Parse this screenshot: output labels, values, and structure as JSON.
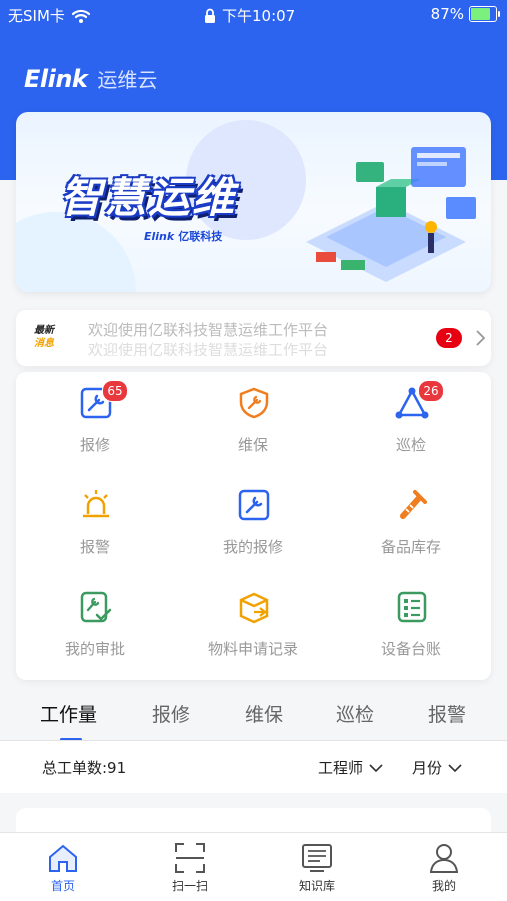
{
  "status_bar": {
    "carrier": "无SIM卡",
    "time": "下午10:07",
    "battery": "87%",
    "battery_level": 0.87
  },
  "app_bar": {
    "logo": "Elink",
    "title": "运维云"
  },
  "banner": {
    "title": "智慧运维",
    "brand": "Elink",
    "company": "亿联科技"
  },
  "notice": {
    "tag_line1": "最新",
    "tag_line2": "消息",
    "text_line1": "欢迎使用亿联科技智慧运维工作平台",
    "text_line2": "欢迎使用亿联科技智慧运维工作平台",
    "count": "2"
  },
  "grid": {
    "items": [
      {
        "label": "报修",
        "badge": "65",
        "icon": "wrench-doc-icon"
      },
      {
        "label": "维保",
        "badge": "",
        "icon": "shield-wrench-icon"
      },
      {
        "label": "巡检",
        "badge": "26",
        "icon": "triangle-nodes-icon"
      },
      {
        "label": "报警",
        "badge": "",
        "icon": "siren-icon"
      },
      {
        "label": "我的报修",
        "badge": "",
        "icon": "wrench-doc-icon"
      },
      {
        "label": "备品库存",
        "badge": "",
        "icon": "bolt-tools-icon"
      },
      {
        "label": "我的审批",
        "badge": "",
        "icon": "approval-icon"
      },
      {
        "label": "物料申请记录",
        "badge": "",
        "icon": "box-icon"
      },
      {
        "label": "设备台账",
        "badge": "",
        "icon": "ledger-icon"
      }
    ]
  },
  "tabs": [
    "工作量",
    "报修",
    "维保",
    "巡检",
    "报警"
  ],
  "stats": {
    "total": "总工单数:91",
    "filter_role": "工程师",
    "filter_period": "月份"
  },
  "bottom_nav": [
    {
      "label": "首页",
      "icon": "home-icon"
    },
    {
      "label": "扫一扫",
      "icon": "scan-icon"
    },
    {
      "label": "知识库",
      "icon": "knowledge-icon"
    },
    {
      "label": "我的",
      "icon": "user-icon"
    }
  ],
  "colors": {
    "primary": "#2c64ef",
    "badge": "#e8383d",
    "accent_orange": "#f07d1e"
  }
}
